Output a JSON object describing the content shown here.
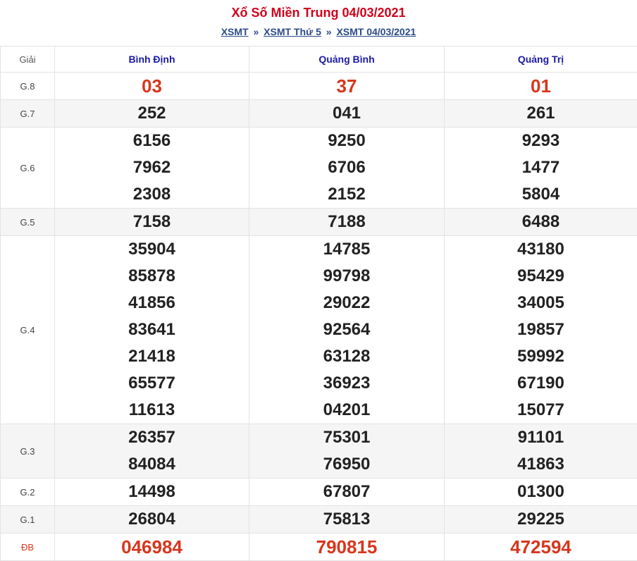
{
  "title": "Xổ Số Miền Trung 04/03/2021",
  "breadcrumb": {
    "items": [
      "XSMT",
      "XSMT Thứ 5",
      "XSMT 04/03/2021"
    ],
    "separator": "»"
  },
  "table": {
    "label_header": "Giải",
    "provinces": [
      "Bình Định",
      "Quảng Bình",
      "Quảng Trị"
    ],
    "rows": [
      {
        "label": "G.8",
        "values": [
          [
            "03"
          ],
          [
            "37"
          ],
          [
            "01"
          ]
        ]
      },
      {
        "label": "G.7",
        "values": [
          [
            "252"
          ],
          [
            "041"
          ],
          [
            "261"
          ]
        ]
      },
      {
        "label": "G.6",
        "values": [
          [
            "6156",
            "7962",
            "2308"
          ],
          [
            "9250",
            "6706",
            "2152"
          ],
          [
            "9293",
            "1477",
            "5804"
          ]
        ]
      },
      {
        "label": "G.5",
        "values": [
          [
            "7158"
          ],
          [
            "7188"
          ],
          [
            "6488"
          ]
        ]
      },
      {
        "label": "G.4",
        "values": [
          [
            "35904",
            "85878",
            "41856",
            "83641",
            "21418",
            "65577",
            "11613"
          ],
          [
            "14785",
            "99798",
            "29022",
            "92564",
            "63128",
            "36923",
            "04201"
          ],
          [
            "43180",
            "95429",
            "34005",
            "19857",
            "59992",
            "67190",
            "15077"
          ]
        ]
      },
      {
        "label": "G.3",
        "values": [
          [
            "26357",
            "84084"
          ],
          [
            "75301",
            "76950"
          ],
          [
            "91101",
            "41863"
          ]
        ]
      },
      {
        "label": "G.2",
        "values": [
          [
            "14498"
          ],
          [
            "67807"
          ],
          [
            "01300"
          ]
        ]
      },
      {
        "label": "G.1",
        "values": [
          [
            "26804"
          ],
          [
            "75813"
          ],
          [
            "29225"
          ]
        ]
      },
      {
        "label": "ĐB",
        "values": [
          [
            "046984"
          ],
          [
            "790815"
          ],
          [
            "472594"
          ]
        ]
      }
    ]
  },
  "colors": {
    "title": "#d0021b",
    "highlight_number": "#d7361d",
    "province_header": "#1a1aa6",
    "link": "#2b4a8a",
    "alt_row": "#f5f5f5"
  }
}
